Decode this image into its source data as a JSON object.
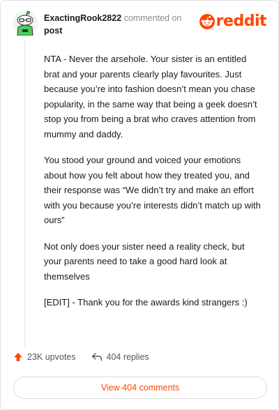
{
  "header": {
    "username": "ExactingRook2822",
    "action_text": "commented on",
    "target_text": "post",
    "logo_text": "reddit"
  },
  "comment": {
    "paragraphs": [
      "NTA - Never the arsehole. Your sister is an entitled brat and your parents clearly play favourites. Just because you’re into fashion doesn’t mean you chase popularity, in the same way that being a geek doesn’t stop you from being a brat who craves attention from mummy and daddy.",
      "You stood your ground and voiced your emotions about how you felt about how they treated you, and their response was “We didn’t try and make an effort with you because you’re interests didn’t match up with ours”",
      "Not only does your sister need a reality check, but your parents need to take a good hard look at themselves",
      "[EDIT] - Thank you for the awards kind strangers :)"
    ]
  },
  "stats": {
    "upvotes": "23K upvotes",
    "replies": "404 replies"
  },
  "footer": {
    "view_button": "View 404 comments"
  },
  "colors": {
    "brand": "#ff4500",
    "avatar_body": "#46d160",
    "text": "#1a1a1b",
    "muted": "#878a8c"
  }
}
